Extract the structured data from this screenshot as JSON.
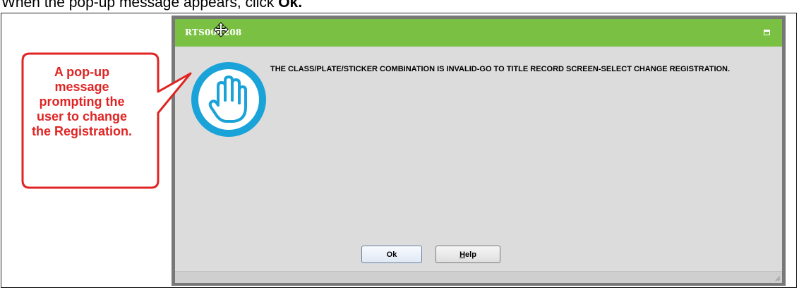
{
  "instruction": {
    "prefix": "When the pop-up message appears, click ",
    "bold": "Ok."
  },
  "dialog": {
    "title": "RTS00C208",
    "message": "THE CLASS/PLATE/STICKER COMBINATION IS INVALID-GO TO TITLE RECORD SCREEN-SELECT CHANGE REGISTRATION.",
    "ok_label": "Ok",
    "help_label_accel": "H",
    "help_label_rest": "elp",
    "icon": "stop-hand-icon",
    "title_bar_color": "#7ac143"
  },
  "callout": {
    "text": "A pop-up message prompting the user to change the Registration.",
    "text_color": "#e02424",
    "border_color": "#e02424"
  }
}
